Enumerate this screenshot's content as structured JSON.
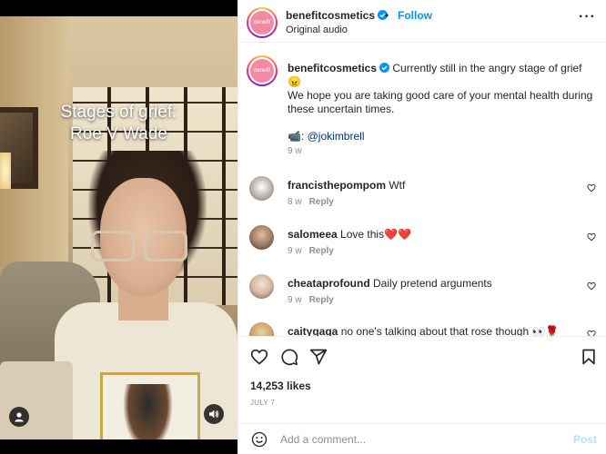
{
  "media": {
    "caption_line1": "Stages of grief:",
    "caption_line2": "Roe V Wade",
    "icons": {
      "user": "user-icon",
      "sound": "sound-icon"
    }
  },
  "header": {
    "username": "benefitcosmetics",
    "separator": "•",
    "follow_label": "Follow",
    "subtitle": "Original audio",
    "avatar_text": "benefit",
    "more_label": "···"
  },
  "caption": {
    "username": "benefitcosmetics",
    "text_line1": "Currently still in the angry stage of grief",
    "emoji": "😠",
    "text_line2": "We hope you are taking good care of your mental health during these uncertain times.",
    "camera_emoji": "📹:",
    "mention": "@jokimbrell",
    "time": "9 w"
  },
  "comments": [
    {
      "username": "francisthepompom",
      "text": "Wtf",
      "time": "8 w",
      "reply": "Reply",
      "avatar_color": "#b9b2a8"
    },
    {
      "username": "salomeea",
      "text": "Love this❤️❤️",
      "time": "9 w",
      "reply": "Reply",
      "avatar_color": "#9a7a5e"
    },
    {
      "username": "cheataprofound",
      "text": "Daily pretend arguments",
      "time": "9 w",
      "reply": "Reply",
      "avatar_color": "#d3b9a4"
    },
    {
      "username": "caitygaga",
      "text": "no one's talking about that rose though 👀🌹",
      "time": "",
      "reply": "",
      "avatar_color": "#c9a06a"
    }
  ],
  "actions": {
    "icons": [
      "heart-icon",
      "comment-icon",
      "share-icon",
      "bookmark-icon"
    ],
    "likes": "14,253 likes",
    "date": "JULY 7"
  },
  "add_comment": {
    "placeholder": "Add a comment...",
    "post_label": "Post"
  },
  "colors": {
    "accent": "#0095f6",
    "post_disabled": "#b2dffc",
    "muted": "#8e8e8e",
    "text": "#262626",
    "brand_pink": "#f28aa5"
  }
}
